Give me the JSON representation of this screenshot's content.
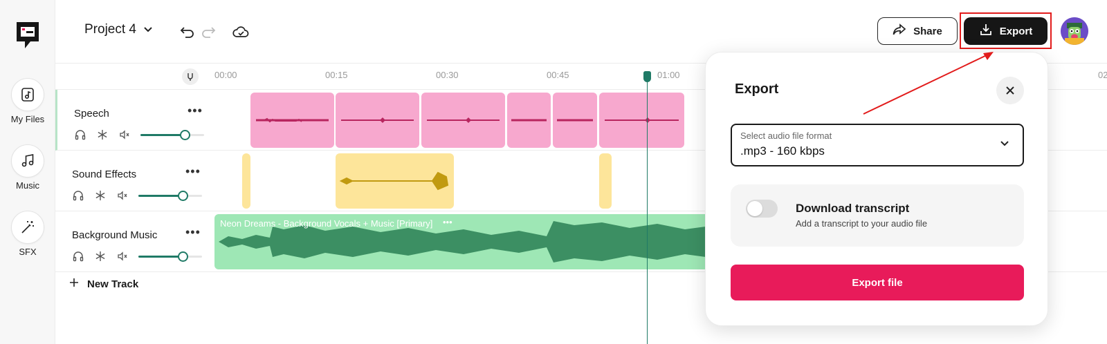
{
  "sidebar": {
    "items": [
      {
        "label": "My Files",
        "icon": "music-file-icon"
      },
      {
        "label": "Music",
        "icon": "music-note-icon"
      },
      {
        "label": "SFX",
        "icon": "magic-wand-icon"
      }
    ]
  },
  "header": {
    "project_name": "Project 4",
    "share_label": "Share",
    "export_label": "Export"
  },
  "ruler": {
    "ticks": [
      "00:00",
      "00:15",
      "00:30",
      "00:45",
      "01:00",
      "02"
    ]
  },
  "tracks": [
    {
      "name": "Speech"
    },
    {
      "name": "Sound Effects"
    },
    {
      "name": "Background Music",
      "clip_title": "Neon Dreams - Background Vocals + Music [Primary]"
    }
  ],
  "new_track_label": "New Track",
  "export_panel": {
    "title": "Export",
    "format_label": "Select audio file format",
    "format_value": ".mp3 - 160 kbps",
    "transcript_title": "Download transcript",
    "transcript_sub": "Add a transcript to your audio file",
    "transcript_enabled": false,
    "export_file_label": "Export file"
  },
  "colors": {
    "accent_green": "#1f7a66",
    "speech_clip": "#f7a8ce",
    "sfx_clip": "#fde59a",
    "music_clip": "#9ee7b5",
    "export_file_button": "#e81b5a",
    "annotation_red": "#e21b1b"
  }
}
